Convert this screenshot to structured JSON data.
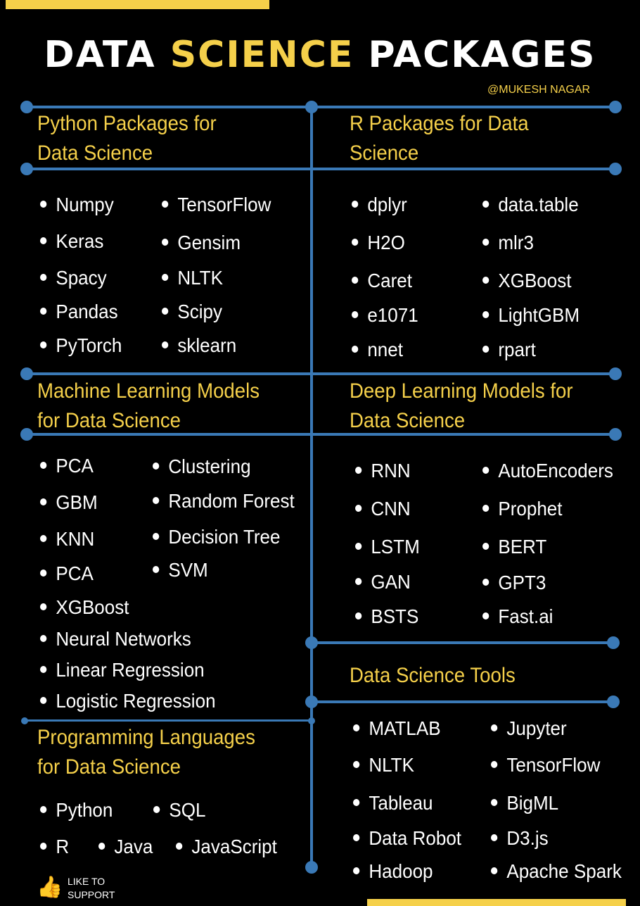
{
  "title": {
    "part1": "DATA ",
    "highlight": "SCIENCE",
    "part2": " PACKAGES"
  },
  "author": "@MUKESH NAGAR",
  "colors": {
    "background": "#000000",
    "accent_yellow": "#f5d04a",
    "line_blue": "#3a79b6",
    "text": "#ffffff"
  },
  "sections": {
    "python": {
      "heading": [
        "Python Packages for",
        "Data Science"
      ],
      "columns": [
        [
          "Numpy",
          "Keras",
          "Spacy",
          "Pandas",
          "PyTorch"
        ],
        [
          "TensorFlow",
          "Gensim",
          "NLTK",
          "Scipy",
          "sklearn"
        ]
      ]
    },
    "r": {
      "heading": [
        "R Packages for Data",
        "Science"
      ],
      "columns": [
        [
          "dplyr",
          "H2O",
          "Caret",
          "e1071",
          "nnet"
        ],
        [
          "data.table",
          "mlr3",
          "XGBoost",
          "LightGBM",
          "rpart"
        ]
      ]
    },
    "ml": {
      "heading": [
        "Machine Learning Models",
        "for Data Science"
      ],
      "columns": [
        [
          "PCA",
          "GBM",
          "KNN",
          "PCA",
          "XGBoost",
          "Neural Networks",
          "Linear Regression",
          "Logistic Regression"
        ],
        [
          "Clustering",
          "Random Forest",
          "Decision Tree",
          "SVM"
        ]
      ]
    },
    "dl": {
      "heading": [
        "Deep Learning Models for",
        "Data Science"
      ],
      "columns": [
        [
          "RNN",
          "CNN",
          "LSTM",
          "GAN",
          "BSTS"
        ],
        [
          "AutoEncoders",
          "Prophet",
          "BERT",
          "GPT3",
          "Fast.ai"
        ]
      ]
    },
    "tools": {
      "heading": [
        "Data Science Tools"
      ],
      "columns": [
        [
          "MATLAB",
          "NLTK",
          "Tableau",
          "Data Robot",
          "Hadoop"
        ],
        [
          "Jupyter",
          "TensorFlow",
          "BigML",
          "D3.js",
          "Apache Spark"
        ]
      ]
    },
    "languages": {
      "heading": [
        "Programming Languages",
        "for Data Science"
      ],
      "columns": [
        [
          "Python",
          "R"
        ],
        [
          "SQL",
          "Java"
        ],
        [
          "JavaScript"
        ]
      ]
    }
  },
  "footer": {
    "icon": "thumbs-up-icon",
    "like_line1": "LIKE TO",
    "like_line2": "SUPPORT"
  }
}
